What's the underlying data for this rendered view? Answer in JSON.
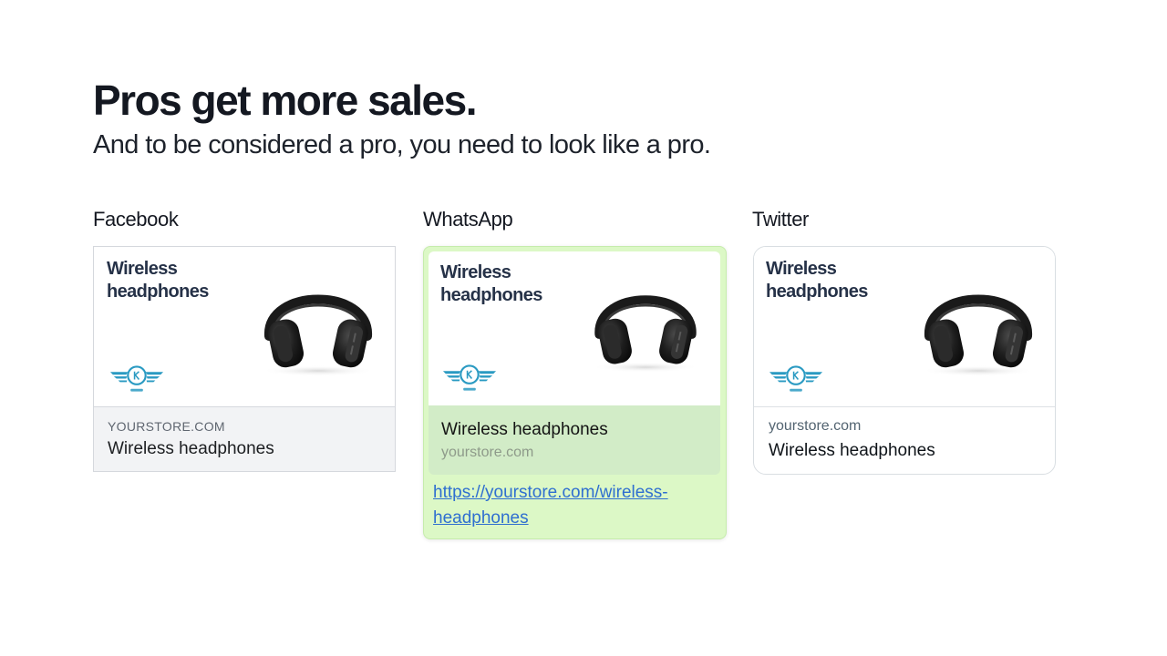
{
  "hero": {
    "title": "Pros get more sales.",
    "subtitle": "And to be considered a pro, you need to look like a pro."
  },
  "colors": {
    "title_text": "#263248",
    "logo_accent": "#2a9ac2",
    "whatsapp_bubble": "#dcf8c6",
    "whatsapp_link": "#2f6fd0"
  },
  "preview_image": {
    "title": "Wireless headphones",
    "product_icon": "headphones-icon",
    "brand_icon": "winged-k-logo-icon"
  },
  "facebook": {
    "label": "Facebook",
    "domain": "YOURSTORE.COM",
    "headline": "Wireless headphones"
  },
  "whatsapp": {
    "label": "WhatsApp",
    "headline": "Wireless headphones",
    "domain": "yourstore.com",
    "link": "https://yourstore.com/wireless-headphones"
  },
  "twitter": {
    "label": "Twitter",
    "domain": "yourstore.com",
    "headline": "Wireless headphones"
  }
}
